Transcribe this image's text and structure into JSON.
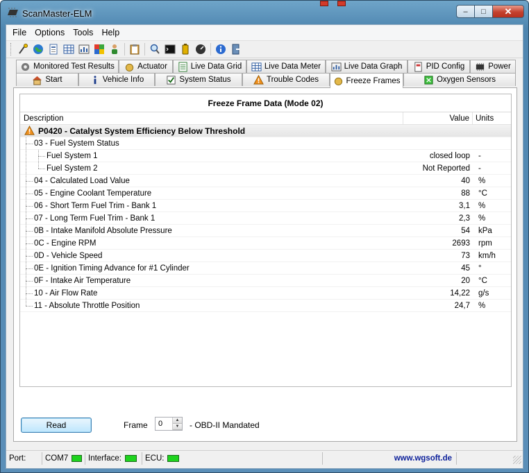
{
  "window": {
    "title": "ScanMaster-ELM",
    "min_glyph": "–",
    "max_glyph": "□",
    "close_glyph": "✕"
  },
  "menu": {
    "items": [
      "File",
      "Options",
      "Tools",
      "Help"
    ]
  },
  "toolbar": {
    "icons": [
      "connect-icon",
      "globe-icon",
      "report-icon",
      "table-icon",
      "meter-icon",
      "chart-icon",
      "person-icon",
      "clipboard-icon",
      "search-icon",
      "terminal-icon",
      "battery-icon",
      "gauge-icon",
      "info-icon",
      "exit-icon"
    ]
  },
  "tabs": {
    "row1": [
      {
        "label": "Monitored Test Results",
        "icon": "gear-icon"
      },
      {
        "label": "Actuator",
        "icon": "hand-icon"
      },
      {
        "label": "Live Data Grid",
        "icon": "list-icon"
      },
      {
        "label": "Live Data Meter",
        "icon": "table-icon"
      },
      {
        "label": "Live Data Graph",
        "icon": "graph-icon"
      },
      {
        "label": "PID Config",
        "icon": "document-icon"
      },
      {
        "label": "Power",
        "icon": "chip-icon"
      }
    ],
    "row2": [
      {
        "label": "Start",
        "icon": "home-icon"
      },
      {
        "label": "Vehicle Info",
        "icon": "info-icon"
      },
      {
        "label": "System Status",
        "icon": "checkbox-icon"
      },
      {
        "label": "Trouble Codes",
        "icon": "warning-icon"
      },
      {
        "label": "Freeze Frames",
        "icon": "hand-icon",
        "active": true
      },
      {
        "label": "Oxygen Sensors",
        "icon": "sensor-icon"
      }
    ]
  },
  "freeze_frame": {
    "title": "Freeze Frame Data (Mode 02)",
    "columns": {
      "description": "Description",
      "value": "Value",
      "units": "Units"
    },
    "dtc_header": "P0420 - Catalyst System Efficiency Below Threshold",
    "rows": [
      {
        "desc": "03 - Fuel System Status",
        "value": "",
        "unit": "",
        "level": 1
      },
      {
        "desc": "Fuel System 1",
        "value": "closed loop",
        "unit": "-",
        "level": 2
      },
      {
        "desc": "Fuel System 2",
        "value": "Not Reported",
        "unit": "-",
        "level": 2
      },
      {
        "desc": "04 - Calculated Load Value",
        "value": "40",
        "unit": "%",
        "level": 1
      },
      {
        "desc": "05 - Engine Coolant Temperature",
        "value": "88",
        "unit": "°C",
        "level": 1
      },
      {
        "desc": "06 - Short Term Fuel Trim - Bank 1",
        "value": "3,1",
        "unit": "%",
        "level": 1
      },
      {
        "desc": "07 - Long Term Fuel Trim - Bank 1",
        "value": "2,3",
        "unit": "%",
        "level": 1
      },
      {
        "desc": "0B - Intake Manifold Absolute Pressure",
        "value": "54",
        "unit": "kPa",
        "level": 1
      },
      {
        "desc": "0C - Engine RPM",
        "value": "2693",
        "unit": "rpm",
        "level": 1
      },
      {
        "desc": "0D - Vehicle Speed",
        "value": "73",
        "unit": "km/h",
        "level": 1
      },
      {
        "desc": "0E - Ignition Timing Advance for #1 Cylinder",
        "value": "45",
        "unit": "°",
        "level": 1
      },
      {
        "desc": "0F - Intake Air Temperature",
        "value": "20",
        "unit": "°C",
        "level": 1
      },
      {
        "desc": "10 - Air Flow Rate",
        "value": "14,22",
        "unit": "g/s",
        "level": 1
      },
      {
        "desc": "11 - Absolute Throttle Position",
        "value": "24,7",
        "unit": "%",
        "level": 1
      }
    ]
  },
  "controls": {
    "read_label": "Read",
    "frame_label": "Frame",
    "frame_value": "0",
    "frame_note": "- OBD-II Mandated"
  },
  "statusbar": {
    "port_label": "Port:",
    "port_value": "COM7",
    "interface_label": "Interface:",
    "ecu_label": "ECU:",
    "link_text": "www.wgsoft.de",
    "led_color": "#1ed31e"
  }
}
